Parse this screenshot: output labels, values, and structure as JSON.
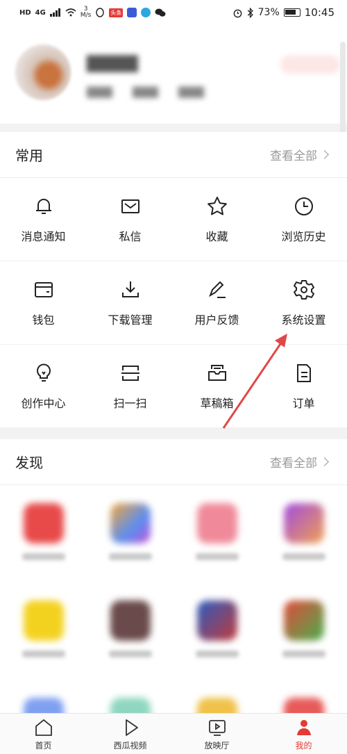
{
  "status_bar": {
    "left": [
      "HD",
      "4G",
      "3",
      "M/s"
    ],
    "badge": "头条",
    "battery": "73%",
    "time": "10:45"
  },
  "common": {
    "title": "常用",
    "see_all": "查看全部",
    "items": [
      {
        "label": "消息通知",
        "icon": "bell-icon"
      },
      {
        "label": "私信",
        "icon": "mail-icon"
      },
      {
        "label": "收藏",
        "icon": "star-icon"
      },
      {
        "label": "浏览历史",
        "icon": "clock-icon"
      },
      {
        "label": "钱包",
        "icon": "wallet-icon"
      },
      {
        "label": "下载管理",
        "icon": "download-icon"
      },
      {
        "label": "用户反馈",
        "icon": "pen-icon"
      },
      {
        "label": "系统设置",
        "icon": "gear-icon"
      },
      {
        "label": "创作中心",
        "icon": "bulb-icon"
      },
      {
        "label": "扫一扫",
        "icon": "scan-icon"
      },
      {
        "label": "草稿箱",
        "icon": "inbox-icon"
      },
      {
        "label": "订单",
        "icon": "document-icon"
      }
    ]
  },
  "discover": {
    "title": "发现",
    "see_all": "查看全部"
  },
  "tabbar": {
    "items": [
      {
        "label": "首页",
        "icon": "home-icon"
      },
      {
        "label": "西瓜视频",
        "icon": "play-icon"
      },
      {
        "label": "放映厅",
        "icon": "tv-icon"
      },
      {
        "label": "我的",
        "icon": "me-icon"
      }
    ]
  },
  "colors": {
    "accent": "#e53935",
    "arrow": "#e04848"
  }
}
